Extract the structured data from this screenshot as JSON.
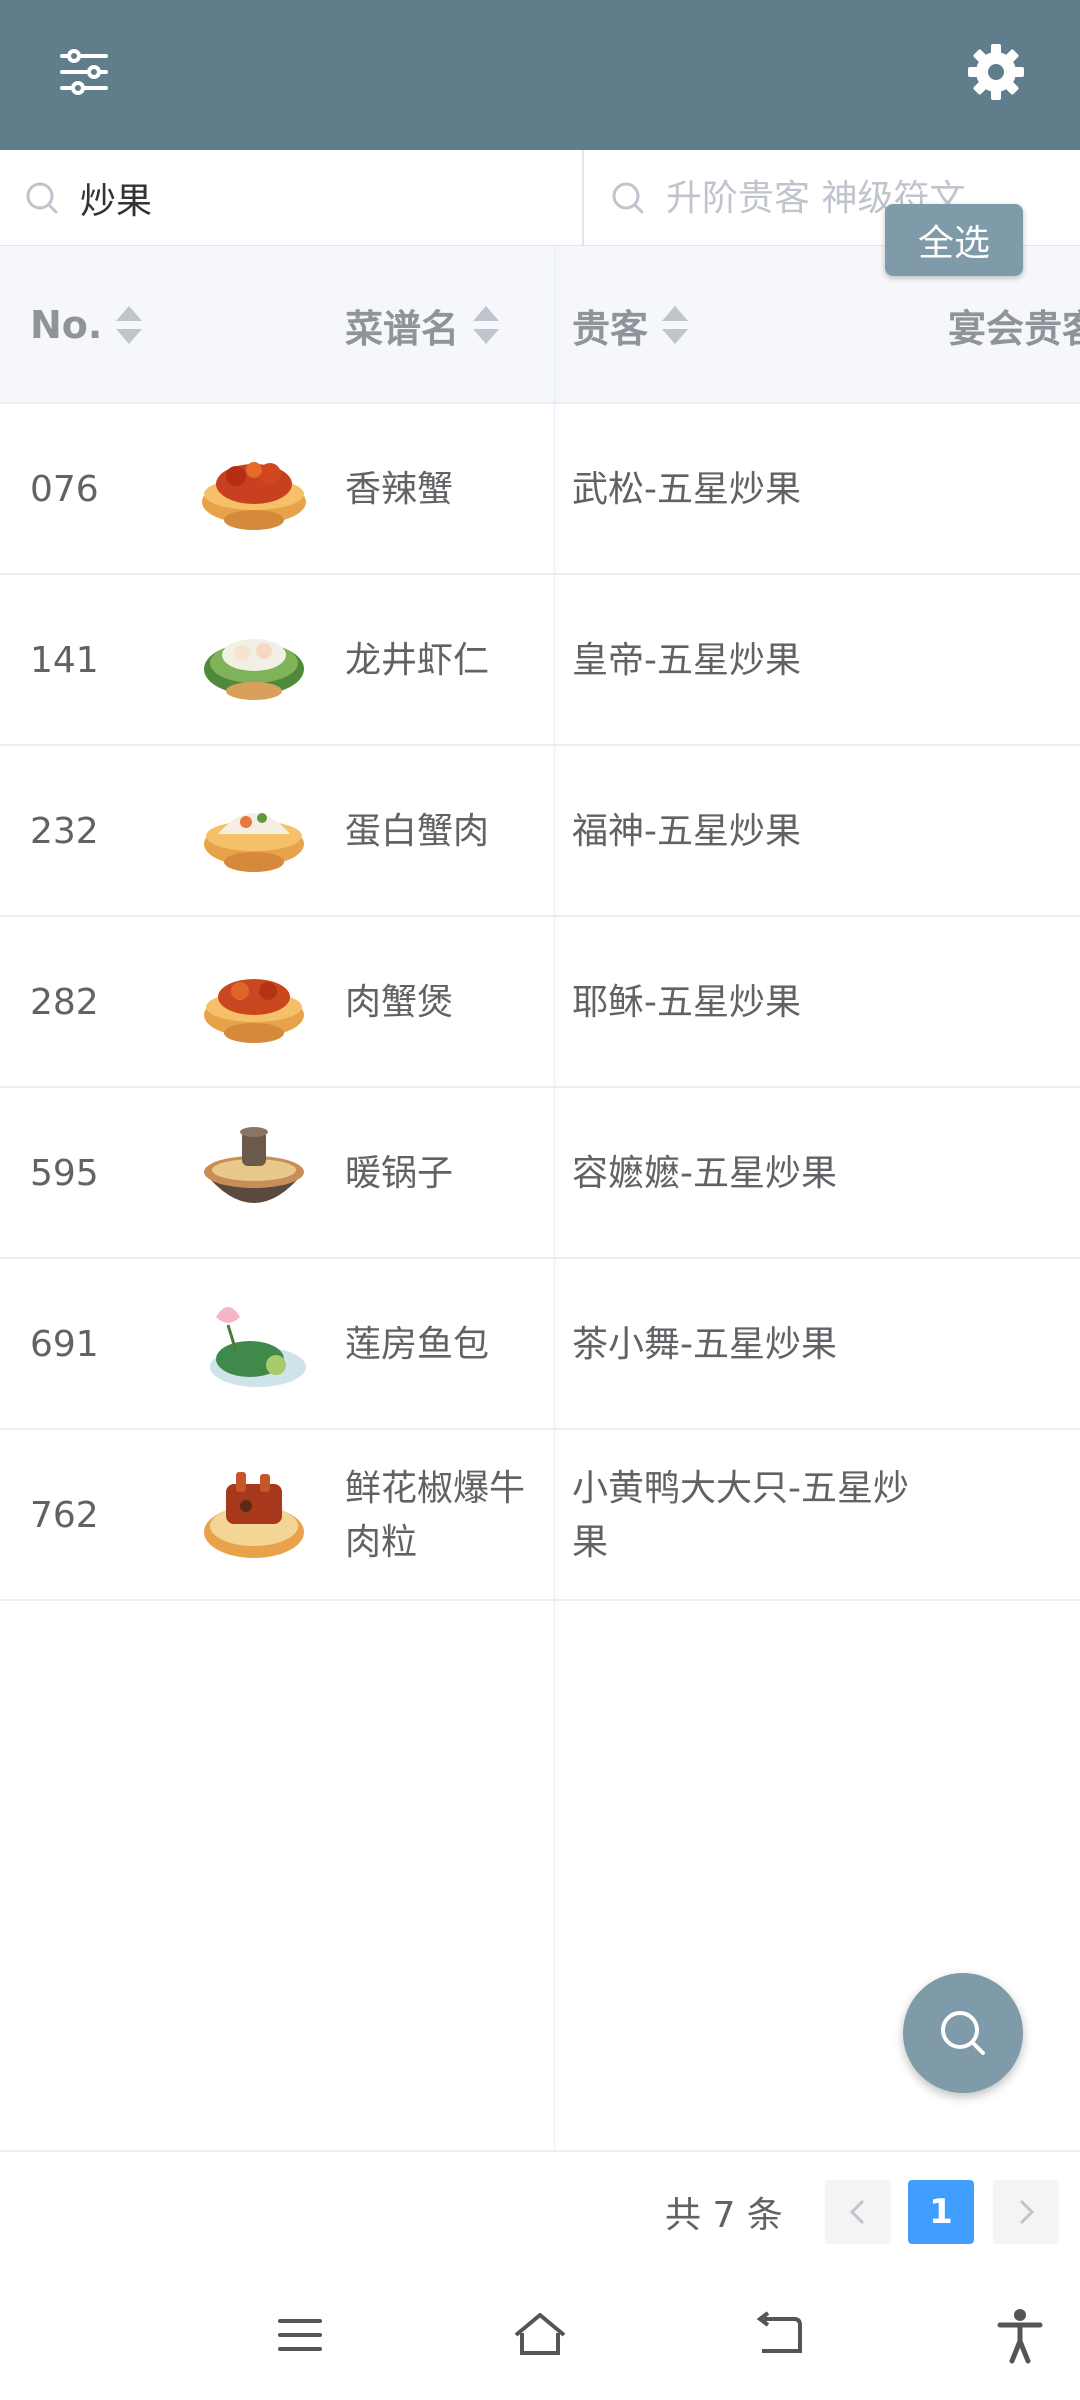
{
  "search": {
    "dish_value": "炒果",
    "guest_placeholder": "升阶贵客 神级符文",
    "select_all_label": "全选"
  },
  "table": {
    "headers": {
      "no": "No.",
      "dish_name": "菜谱名",
      "guest": "贵客",
      "banquet_guest": "宴会贵客"
    },
    "rows": [
      {
        "no": "076",
        "name": "香辣蟹",
        "guest": "武松-五星炒果",
        "icon": "spicy-crab-dish-icon"
      },
      {
        "no": "141",
        "name": "龙井虾仁",
        "guest": "皇帝-五星炒果",
        "icon": "longjing-shrimp-dish-icon"
      },
      {
        "no": "232",
        "name": "蛋白蟹肉",
        "guest": "福神-五星炒果",
        "icon": "egg-white-crab-dish-icon"
      },
      {
        "no": "282",
        "name": "肉蟹煲",
        "guest": "耶稣-五星炒果",
        "icon": "crab-pot-dish-icon"
      },
      {
        "no": "595",
        "name": "暖锅子",
        "guest": "容嬷嬷-五星炒果",
        "icon": "hot-pot-dish-icon"
      },
      {
        "no": "691",
        "name": "莲房鱼包",
        "guest": "茶小舞-五星炒果",
        "icon": "lotus-fish-dish-icon"
      },
      {
        "no": "762",
        "name": "鲜花椒爆牛肉粒",
        "guest": "小黄鸭大大只-五星炒果",
        "icon": "pepper-beef-dish-icon"
      }
    ]
  },
  "pagination": {
    "total": "共 7 条",
    "current_page": "1"
  },
  "colors": {
    "topbar": "#607d8b",
    "accent": "#409eff",
    "fab": "#7f9aa8"
  },
  "icons": [
    "sliders-icon",
    "gear-icon",
    "search-icon",
    "menu-icon",
    "home-icon",
    "back-icon",
    "accessibility-icon"
  ]
}
